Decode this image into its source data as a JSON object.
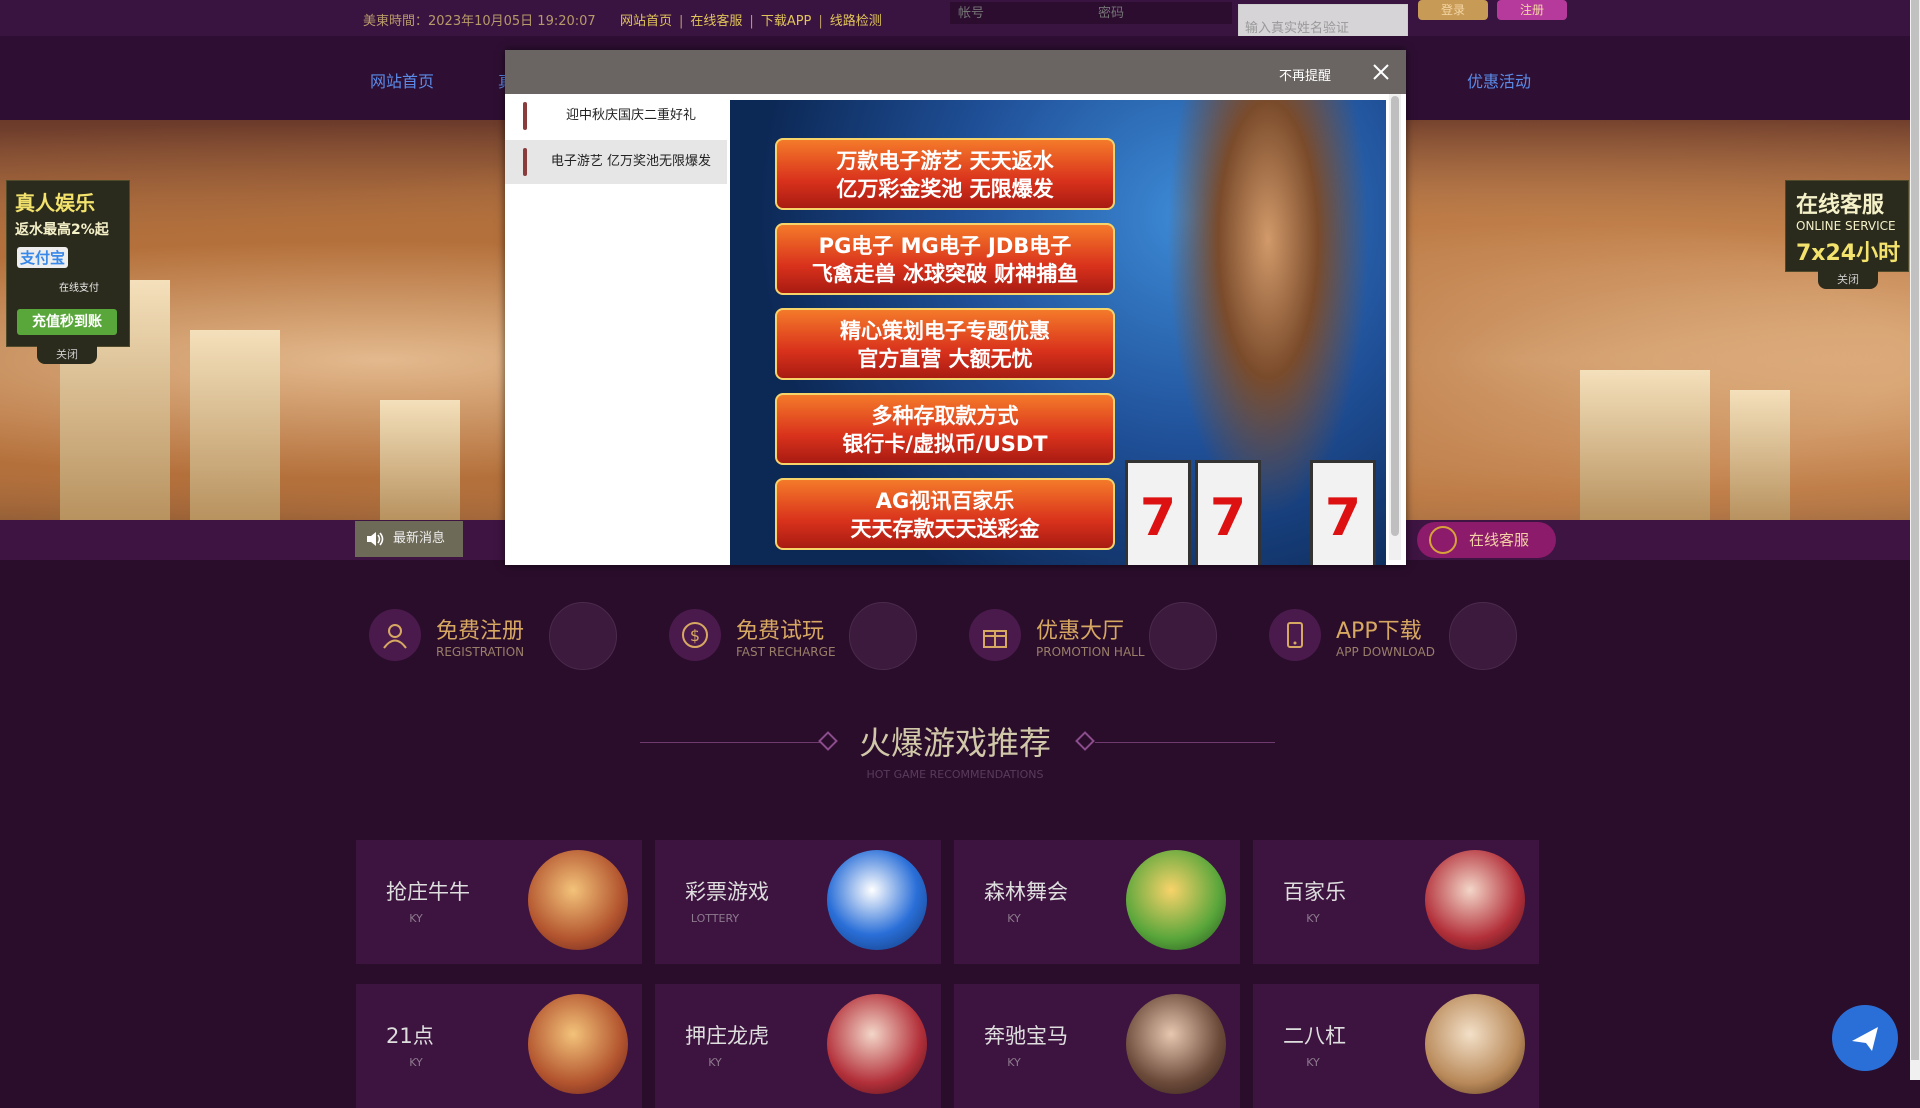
{
  "topbar": {
    "time": "美東時間：2023年10月05日 19:20:07",
    "links": [
      "网站首页",
      "在线客服",
      "下载APP",
      "线路检测"
    ],
    "account_placeholder": "帐号",
    "password_placeholder": "密码",
    "verify_placeholder": "输入真实姓名验证",
    "login_label": "登录",
    "register_label": "注册"
  },
  "nav": {
    "items": [
      "网站首页",
      "真",
      "优惠活动"
    ]
  },
  "left_float": {
    "title": "真人娱乐",
    "rebate": "返水最高2%起",
    "pay1": "支付宝",
    "pay2": "在线支付",
    "pay3": "充值秒到账",
    "close": "关闭"
  },
  "right_float": {
    "title": "在线客服",
    "sub": "ONLINE SERVICE",
    "hours": "7x24小时",
    "close": "关闭"
  },
  "news_label": "最新消息",
  "online_service": "在线客服",
  "modal": {
    "no_remind": "不再提醒",
    "tabs": [
      "迎中秋庆国庆二重好礼",
      "电子游艺 亿万奖池无限爆发"
    ],
    "ribbons": [
      [
        "万款电子游艺 天天返水",
        "亿万彩金奖池 无限爆发"
      ],
      [
        "PG电子 MG电子 JDB电子",
        "飞禽走兽 冰球突破 财神捕鱼"
      ],
      [
        "精心策划电子专题优惠",
        "官方直营 大额无忧"
      ],
      [
        "多种存取款方式",
        "银行卡/虚拟币/USDT"
      ],
      [
        "AG视讯百家乐",
        "天天存款天天送彩金"
      ]
    ],
    "slot_symbol": "7"
  },
  "quick_links": [
    {
      "title": "免费注册",
      "sub": "REGISTRATION",
      "icon": "user-icon"
    },
    {
      "title": "免费试玩",
      "sub": "FAST RECHARGE",
      "icon": "dollar-icon"
    },
    {
      "title": "优惠大厅",
      "sub": "PROMOTION HALL",
      "icon": "gift-icon"
    },
    {
      "title": "APP下载",
      "sub": "APP DOWNLOAD",
      "icon": "phone-icon"
    }
  ],
  "hot_section": {
    "title": "火爆游戏推荐",
    "sub": "HOT GAME RECOMMENDATIONS"
  },
  "games": [
    {
      "name": "抢庄牛牛",
      "tag": "KY"
    },
    {
      "name": "彩票游戏",
      "tag": "LOTTERY"
    },
    {
      "name": "森林舞会",
      "tag": "KY"
    },
    {
      "name": "百家乐",
      "tag": "KY"
    },
    {
      "name": "21点",
      "tag": "KY"
    },
    {
      "name": "押庄龙虎",
      "tag": "KY"
    },
    {
      "name": "奔驰宝马",
      "tag": "KY"
    },
    {
      "name": "二八杠",
      "tag": "KY"
    }
  ],
  "colors": {
    "page_bg": "#2a0d2b",
    "accent_gold": "#d7a861",
    "nav_link": "#5b8be8",
    "card_bg": "#3d1440"
  }
}
